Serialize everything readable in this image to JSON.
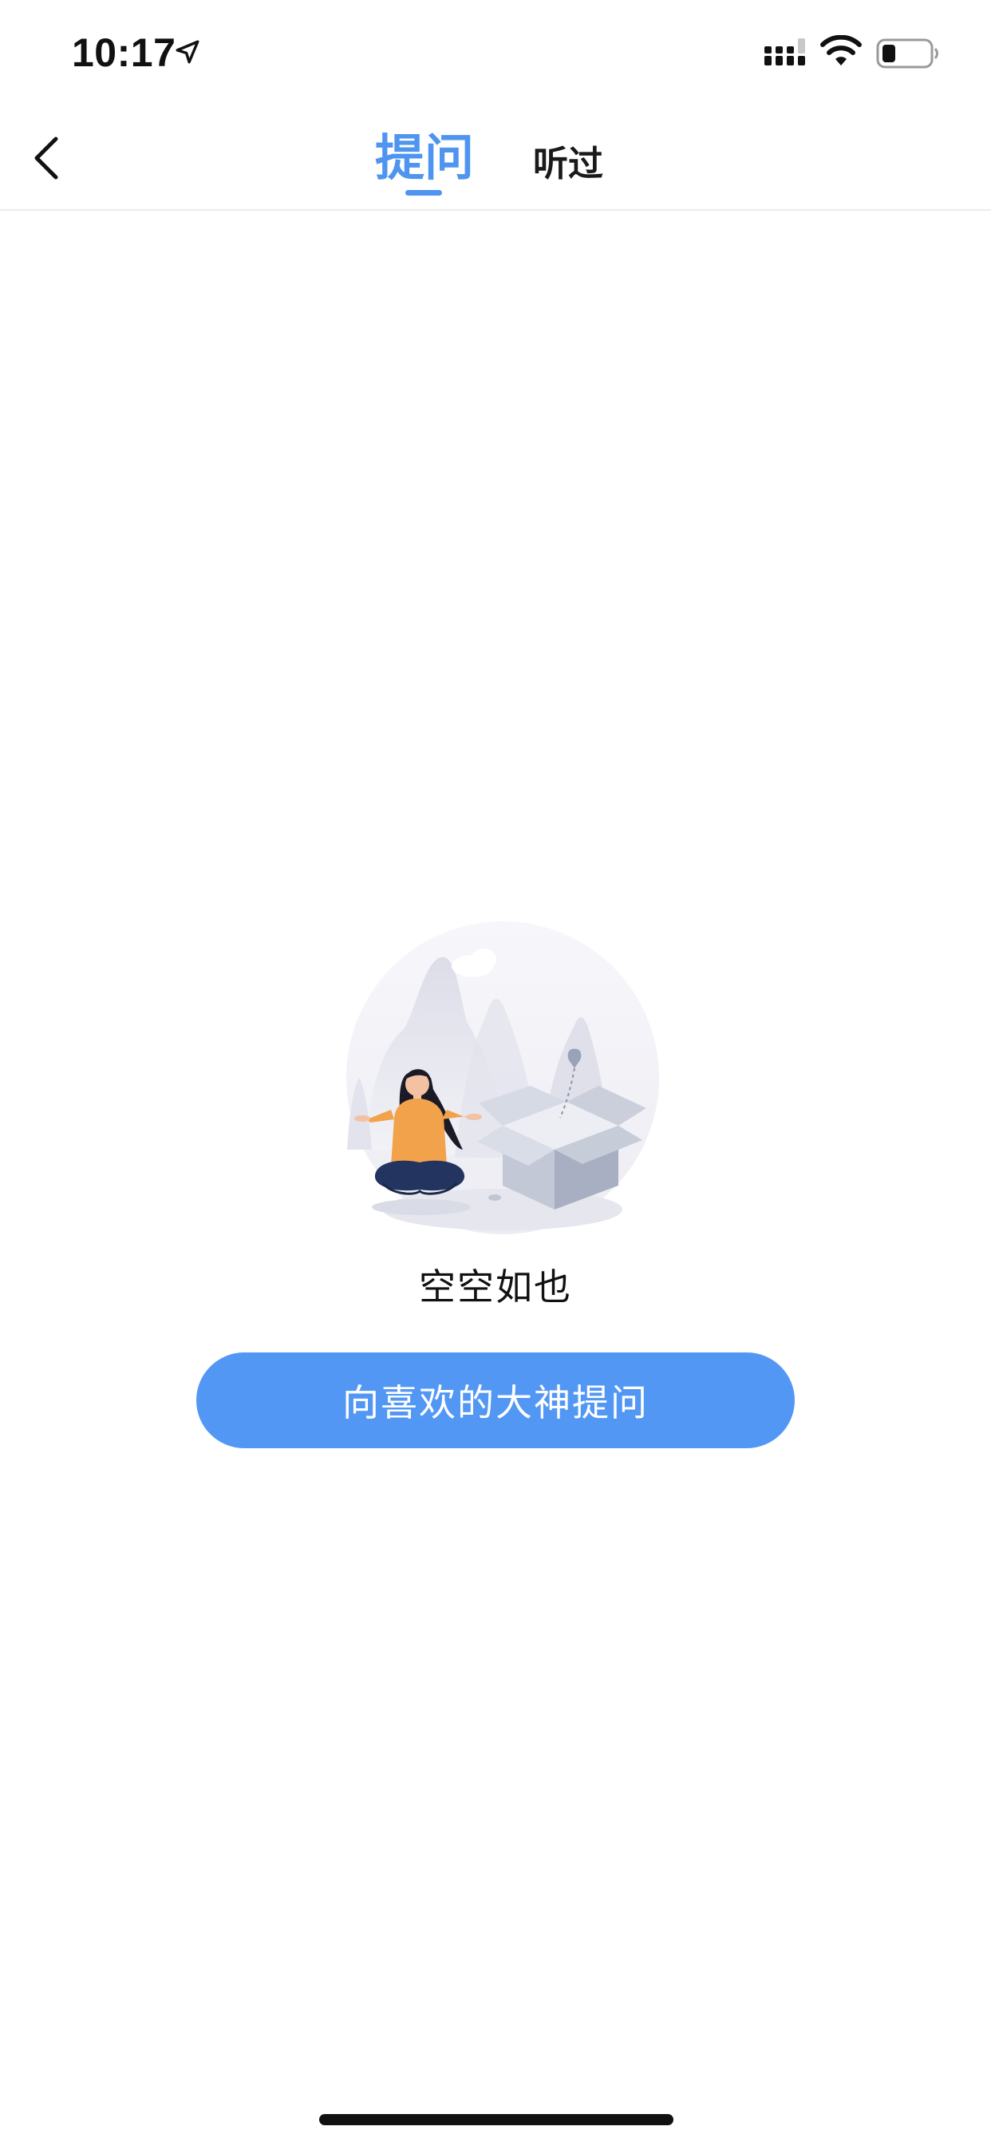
{
  "status_bar": {
    "time": "10:17",
    "icons": [
      "location-arrow-icon",
      "signal-icon",
      "wifi-icon",
      "battery-icon"
    ]
  },
  "nav": {
    "back_icon": "chevron-left-icon",
    "tabs": [
      {
        "label": "提问",
        "active": true
      },
      {
        "label": "听过",
        "active": false
      }
    ]
  },
  "empty_state": {
    "illustration": "meditating-person-empty-box-illustration",
    "message": "空空如也",
    "button_label": "向喜欢的大神提问"
  },
  "colors": {
    "accent": "#4f95ef",
    "button": "#5397f5",
    "text": "#111111",
    "background": "#ffffff"
  }
}
